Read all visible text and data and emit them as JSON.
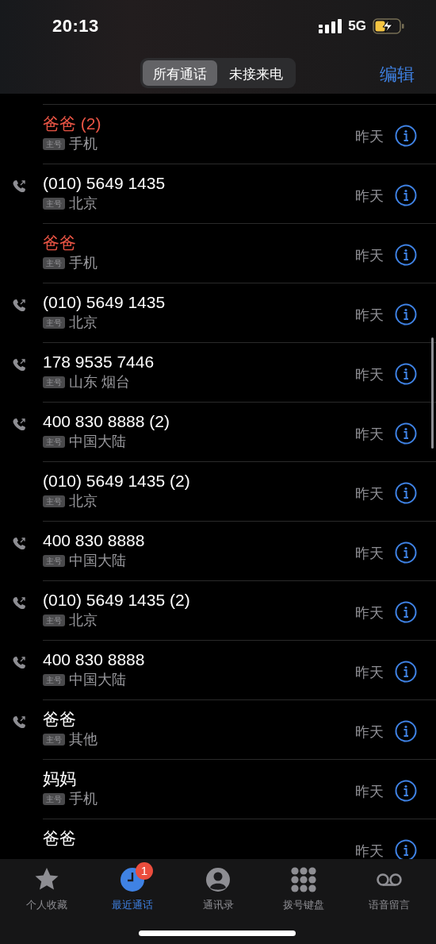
{
  "status_bar": {
    "time": "20:13",
    "network": "5G"
  },
  "header": {
    "segments": [
      {
        "label": "所有通话",
        "selected": true
      },
      {
        "label": "未接来电",
        "selected": false
      }
    ],
    "edit": "编辑"
  },
  "calls": [
    {
      "name": "爸爸 (2)",
      "missed": true,
      "outgoing": false,
      "badge": "主号",
      "detail": "手机",
      "date": "昨天"
    },
    {
      "name": "(010) 5649 1435",
      "missed": false,
      "outgoing": true,
      "badge": "主号",
      "detail": "北京",
      "date": "昨天"
    },
    {
      "name": "爸爸",
      "missed": true,
      "outgoing": false,
      "badge": "主号",
      "detail": "手机",
      "date": "昨天"
    },
    {
      "name": "(010) 5649 1435",
      "missed": false,
      "outgoing": true,
      "badge": "主号",
      "detail": "北京",
      "date": "昨天"
    },
    {
      "name": "178 9535 7446",
      "missed": false,
      "outgoing": true,
      "badge": "主号",
      "detail": "山东 烟台",
      "date": "昨天"
    },
    {
      "name": "400 830 8888 (2)",
      "missed": false,
      "outgoing": true,
      "badge": "主号",
      "detail": "中国大陆",
      "date": "昨天"
    },
    {
      "name": "(010) 5649 1435 (2)",
      "missed": false,
      "outgoing": false,
      "badge": "主号",
      "detail": "北京",
      "date": "昨天"
    },
    {
      "name": "400 830 8888",
      "missed": false,
      "outgoing": true,
      "badge": "主号",
      "detail": "中国大陆",
      "date": "昨天"
    },
    {
      "name": "(010) 5649 1435 (2)",
      "missed": false,
      "outgoing": true,
      "badge": "主号",
      "detail": "北京",
      "date": "昨天"
    },
    {
      "name": "400 830 8888",
      "missed": false,
      "outgoing": true,
      "badge": "主号",
      "detail": "中国大陆",
      "date": "昨天"
    },
    {
      "name": "爸爸",
      "missed": false,
      "outgoing": true,
      "badge": "主号",
      "detail": "其他",
      "date": "昨天"
    },
    {
      "name": "妈妈",
      "missed": false,
      "outgoing": false,
      "badge": "主号",
      "detail": "手机",
      "date": "昨天"
    },
    {
      "name": "爸爸",
      "missed": false,
      "outgoing": false,
      "date": "昨天"
    }
  ],
  "tab_bar": [
    {
      "kind": "star",
      "label": "个人收藏",
      "selected": false
    },
    {
      "kind": "clock",
      "label": "最近通话",
      "selected": true,
      "badge": "1"
    },
    {
      "kind": "person",
      "label": "通讯录",
      "selected": false
    },
    {
      "kind": "keypad",
      "label": "拨号键盘",
      "selected": false
    },
    {
      "kind": "voicemail",
      "label": "语音留言",
      "selected": false
    }
  ]
}
